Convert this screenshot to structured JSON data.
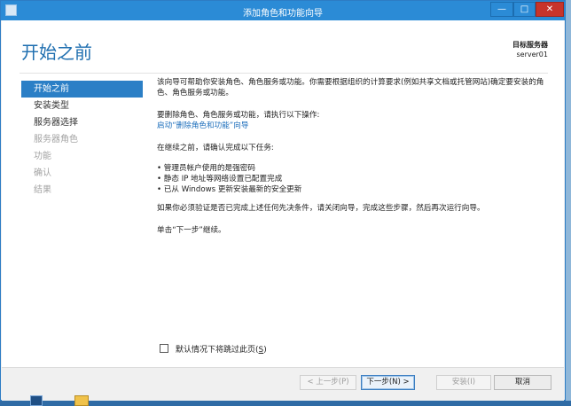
{
  "window": {
    "title": "添加角色和功能向导",
    "controls": {
      "minimize": "—",
      "maximize": "□",
      "close": "✕"
    }
  },
  "header": {
    "page_title": "开始之前",
    "destination_label": "目标服务器",
    "destination_server": "server01"
  },
  "nav": {
    "items": [
      {
        "label": "开始之前",
        "state": "active"
      },
      {
        "label": "安装类型",
        "state": "enabled"
      },
      {
        "label": "服务器选择",
        "state": "enabled"
      },
      {
        "label": "服务器角色",
        "state": "disabled"
      },
      {
        "label": "功能",
        "state": "disabled"
      },
      {
        "label": "确认",
        "state": "disabled"
      },
      {
        "label": "结果",
        "state": "disabled"
      }
    ]
  },
  "main": {
    "intro": "该向导可帮助你安装角色、角色服务或功能。你需要根据组织的计算要求(例如共享文档或托管网站)确定要安装的角色、角色服务或功能。",
    "remove_prompt": "要删除角色、角色服务或功能，请执行以下操作:",
    "remove_link": "启动“删除角色和功能”向导",
    "before_continue": "在继续之前，请确认完成以下任务:",
    "tasks": [
      "• 管理员帐户使用的是强密码",
      "• 静态 IP 地址等网络设置已配置完成",
      "• 已从 Windows 更新安装最新的安全更新"
    ],
    "verify_text": "如果你必须验证是否已完成上述任何先决条件，请关闭向导，完成这些步骤，然后再次运行向导。",
    "next_text": "单击“下一步”继续。"
  },
  "skip": {
    "label_main": "默认情况下将跳过此页(",
    "label_key": "S",
    "label_end": ")",
    "checked": false
  },
  "footer": {
    "prev_label": "< 上一步(P)",
    "next_label": "下一步(N) >",
    "install_label": "安装(I)",
    "cancel_label": "取消"
  },
  "colors": {
    "title_bar": "#2b8bd6",
    "accent": "#2b7fc6",
    "link": "#1e6fbc",
    "close_button": "#c7342b"
  }
}
